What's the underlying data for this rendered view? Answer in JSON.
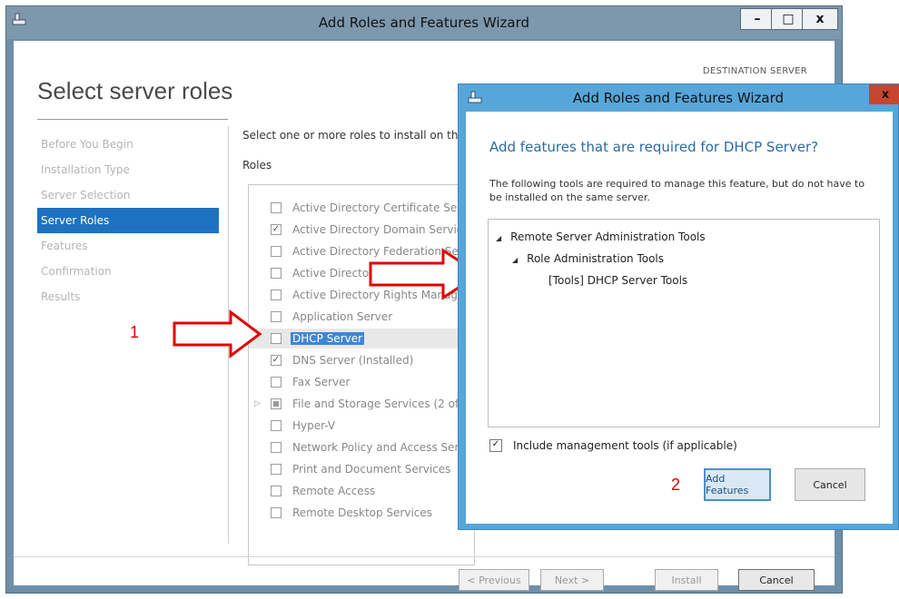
{
  "main_window": {
    "title": "Add Roles and Features Wizard",
    "page_title": "Select server roles",
    "destination_label": "DESTINATION SERVER",
    "instructions": "Select one or more roles to install on th",
    "roles_label": "Roles",
    "nav": [
      {
        "label": "Before You Begin"
      },
      {
        "label": "Installation Type"
      },
      {
        "label": "Server Selection"
      },
      {
        "label": "Server Roles"
      },
      {
        "label": "Features"
      },
      {
        "label": "Confirmation"
      },
      {
        "label": "Results"
      }
    ],
    "roles": [
      {
        "label": "Active Directory Certificate Serv",
        "checked": ""
      },
      {
        "label": "Active Directory Domain Service",
        "checked": "✓"
      },
      {
        "label": "Active Directory Federation Ser",
        "checked": ""
      },
      {
        "label": "Active Directory Lightweight D",
        "checked": ""
      },
      {
        "label": "Active Directory Rights Manag",
        "checked": ""
      },
      {
        "label": "Application Server",
        "checked": ""
      },
      {
        "label": "DHCP Server",
        "checked": ""
      },
      {
        "label": "DNS Server (Installed)",
        "checked": "✓"
      },
      {
        "label": "Fax Server",
        "checked": ""
      },
      {
        "label": "File and Storage Services (2 of",
        "checked": ""
      },
      {
        "label": "Hyper-V",
        "checked": ""
      },
      {
        "label": "Network Policy and Access Serv",
        "checked": ""
      },
      {
        "label": "Print and Document Services",
        "checked": ""
      },
      {
        "label": "Remote Access",
        "checked": ""
      },
      {
        "label": "Remote Desktop Services",
        "checked": ""
      }
    ],
    "footer": {
      "previous": "< Previous",
      "next": "Next >",
      "install": "Install",
      "cancel": "Cancel"
    },
    "window_buttons": {
      "minimize": "–",
      "maximize": "□",
      "close": "x"
    }
  },
  "annotations": {
    "step1": "1",
    "step2": "2",
    "color": "#e00000"
  },
  "dialog": {
    "title": "Add Roles and Features Wizard",
    "close": "x",
    "heading": "Add features that are required for DHCP Server?",
    "description": "The following tools are required to manage this feature, but do not have to be installed on the same server.",
    "tree": [
      {
        "label": "Remote Server Administration Tools",
        "arrow": "◢"
      },
      {
        "label": "Role Administration Tools",
        "arrow": "◢"
      },
      {
        "label": "[Tools] DHCP Server Tools",
        "arrow": ""
      }
    ],
    "include_label": "Include management tools (if applicable)",
    "include_checked": "✓",
    "add_features": "Add Features",
    "cancel": "Cancel"
  },
  "colors": {
    "selected_nav": "#1e72c0",
    "dialog_frame": "#56a6da",
    "heading_blue": "#2a6ca5"
  }
}
